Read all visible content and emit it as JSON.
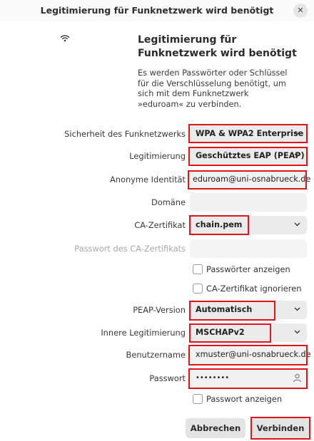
{
  "window": {
    "title": "Legitimierung für Funknetzwerk wird benötigt",
    "close_glyph": "✕"
  },
  "header": {
    "icon": "wifi-icon",
    "heading": "Legitimierung für Funknetzwerk wird benötigt",
    "description": "Es werden Passwörter oder Schlüssel für die Verschlüsselung benötigt, um sich mit dem Funknetzwerk »eduroam« zu verbinden."
  },
  "form": {
    "security": {
      "label": "Sicherheit des Funknetzwerks",
      "value": "WPA & WPA2 Enterprise"
    },
    "auth": {
      "label": "Legitimierung",
      "value": "Geschütztes EAP (PEAP)"
    },
    "anonymous_identity": {
      "label": "Anonyme Identität",
      "value": "eduroam@uni-osnabrueck.de"
    },
    "domain": {
      "label": "Domäne",
      "value": ""
    },
    "ca_cert": {
      "label": "CA-Zertifikat",
      "value": "chain.pem"
    },
    "ca_password": {
      "label": "Passwort des CA-Zertifikats",
      "value": ""
    },
    "show_passwords": {
      "label": "Passwörter anzeigen",
      "checked": false
    },
    "ignore_ca": {
      "label": "CA-Zertifikat ignorieren",
      "checked": false
    },
    "peap_version": {
      "label": "PEAP-Version",
      "value": "Automatisch"
    },
    "inner_auth": {
      "label": "Innere Legitimierung",
      "value": "MSCHAPv2"
    },
    "username": {
      "label": "Benutzername",
      "value": "xmuster@uni-osnabrueck.de"
    },
    "password": {
      "label": "Passwort",
      "value": "••••••••"
    },
    "show_password": {
      "label": "Passwort anzeigen",
      "checked": false
    }
  },
  "buttons": {
    "cancel": "Abbrechen",
    "connect": "Verbinden"
  },
  "colors": {
    "highlight": "#e0141b",
    "control_bg": "#ebebeb"
  }
}
